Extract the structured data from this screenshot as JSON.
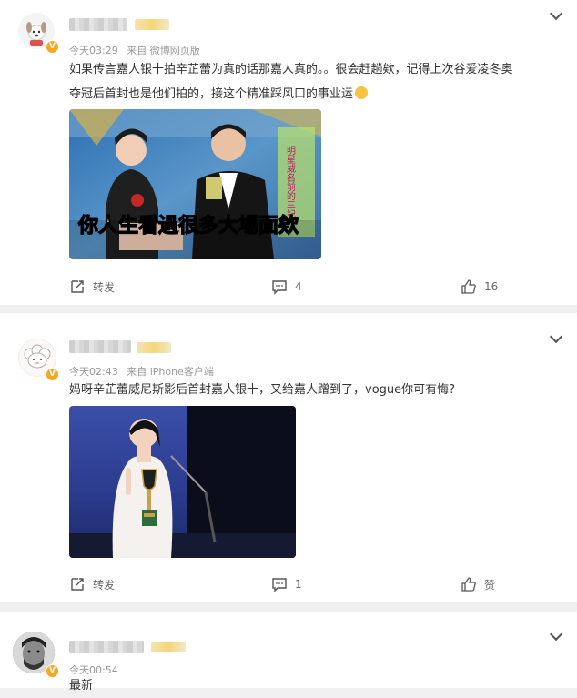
{
  "posts": [
    {
      "time": "今天03:29",
      "source": "来自 微博网页版",
      "text_line1": "如果传言嘉人银十拍辛芷蕾为真的话那嘉人真的。。很会赶趟欸，记得上次谷爱凌冬奥",
      "text_line2": "夺冠后首封也是他们拍的，接这个精准踩风口的事业运",
      "image_caption": "你人生看過很多大場面欸",
      "image_side_text": "明星威名前的三記",
      "repost_label": "转发",
      "comment_count": "4",
      "like_count": "16"
    },
    {
      "time": "今天02:43",
      "source": "来自 iPhone客户端",
      "text_line1": "妈呀辛芷蕾威尼斯影后首封嘉人银十，又给嘉人蹭到了，vogue你可有悔?",
      "repost_label": "转发",
      "comment_count": "1",
      "like_count": "赞"
    },
    {
      "time": "今天00:54",
      "text_line1": "最新"
    }
  ],
  "colors": {
    "background": "#f0f0f0",
    "card": "#ffffff",
    "meta_text": "#999999",
    "badge": "#f6a623"
  },
  "icons": [
    "chevron-down-icon",
    "repost-icon",
    "comment-icon",
    "like-icon",
    "verified-badge-icon",
    "emoji-icon"
  ]
}
